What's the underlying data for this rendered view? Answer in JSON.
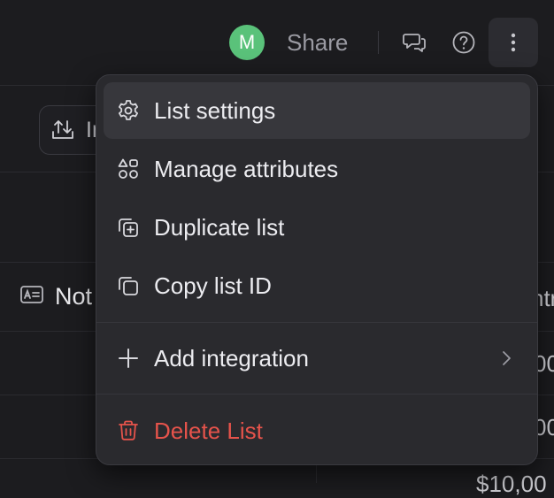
{
  "topbar": {
    "avatar_initial": "M",
    "share_label": "Share",
    "icons": [
      "chat-icon",
      "help-icon",
      "more-vertical-icon"
    ]
  },
  "toolbar": {
    "import_label": "Im"
  },
  "table": {
    "notes_header": "Not",
    "right_header_fragment": "ntr",
    "row_values": [
      "00",
      "00",
      "$10,00"
    ]
  },
  "menu": {
    "items": [
      {
        "label": "List settings",
        "icon": "gear-icon"
      },
      {
        "label": "Manage attributes",
        "icon": "attributes-icon"
      },
      {
        "label": "Duplicate list",
        "icon": "duplicate-icon"
      },
      {
        "label": "Copy list ID",
        "icon": "copy-icon"
      },
      {
        "label": "Add integration",
        "icon": "plus-icon"
      },
      {
        "label": "Delete List",
        "icon": "trash-icon"
      }
    ]
  },
  "colors": {
    "background": "#1c1c1f",
    "menu_bg": "#2a2a2e",
    "avatar": "#5ac27a",
    "danger": "#e5534b"
  }
}
